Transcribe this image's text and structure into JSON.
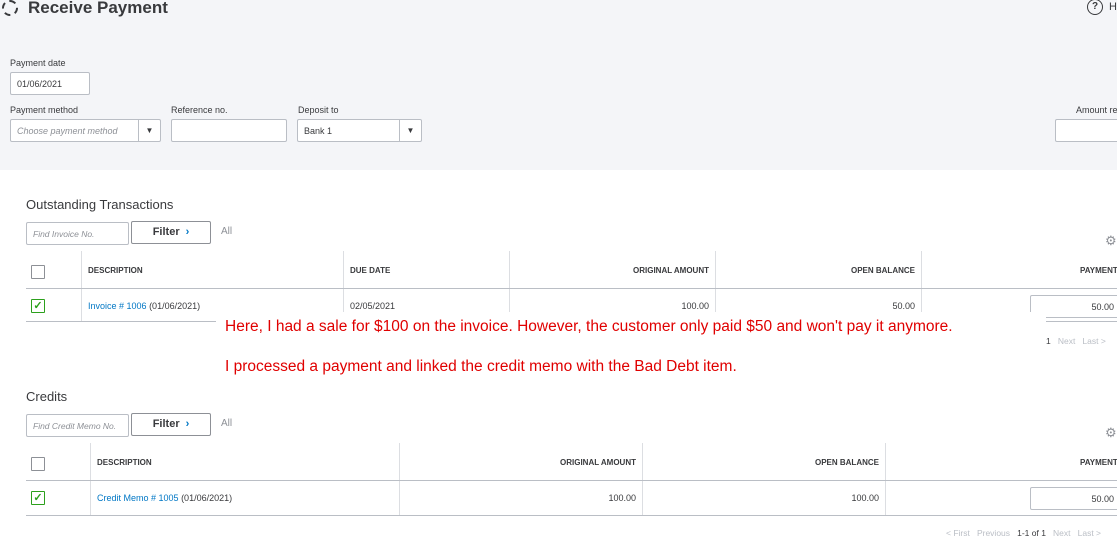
{
  "header": {
    "title": "Receive Payment",
    "help": "H"
  },
  "form": {
    "payment_date_label": "Payment date",
    "payment_date": "01/06/2021",
    "payment_method_label": "Payment method",
    "payment_method_placeholder": "Choose payment method",
    "reference_label": "Reference no.",
    "reference_value": "",
    "deposit_label": "Deposit to",
    "deposit_value": "Bank 1",
    "amount_label": "Amount re"
  },
  "outstanding": {
    "title": "Outstanding Transactions",
    "search_placeholder": "Find Invoice No.",
    "filter": "Filter",
    "all": "All",
    "columns": [
      "DESCRIPTION",
      "DUE DATE",
      "ORIGINAL AMOUNT",
      "OPEN BALANCE",
      "PAYMENT"
    ],
    "rows": [
      {
        "checked": true,
        "link": "Invoice # 1006",
        "date": "(01/06/2021)",
        "due": "02/05/2021",
        "original": "100.00",
        "open": "50.00",
        "payment": "50.00"
      }
    ],
    "pagination": {
      "range": "1",
      "next": "Next",
      "last": "Last >"
    }
  },
  "credits": {
    "title": "Credits",
    "search_placeholder": "Find Credit Memo No.",
    "filter": "Filter",
    "all": "All",
    "columns": [
      "DESCRIPTION",
      "ORIGINAL AMOUNT",
      "OPEN BALANCE",
      "PAYMENT"
    ],
    "rows": [
      {
        "checked": true,
        "link": "Credit Memo # 1005",
        "date": "(01/06/2021)",
        "original": "100.00",
        "open": "100.00",
        "payment": "50.00"
      }
    ],
    "pagination": {
      "first": "< First",
      "previous": "Previous",
      "range": "1-1 of 1",
      "next": "Next",
      "last": "Last >"
    }
  },
  "annotation": {
    "line1": "Here, I had a sale for $100 on the invoice. However, the customer only paid $50 and won't pay it anymore.",
    "line2": "I processed a payment and linked the credit memo with the Bad Debt item."
  }
}
